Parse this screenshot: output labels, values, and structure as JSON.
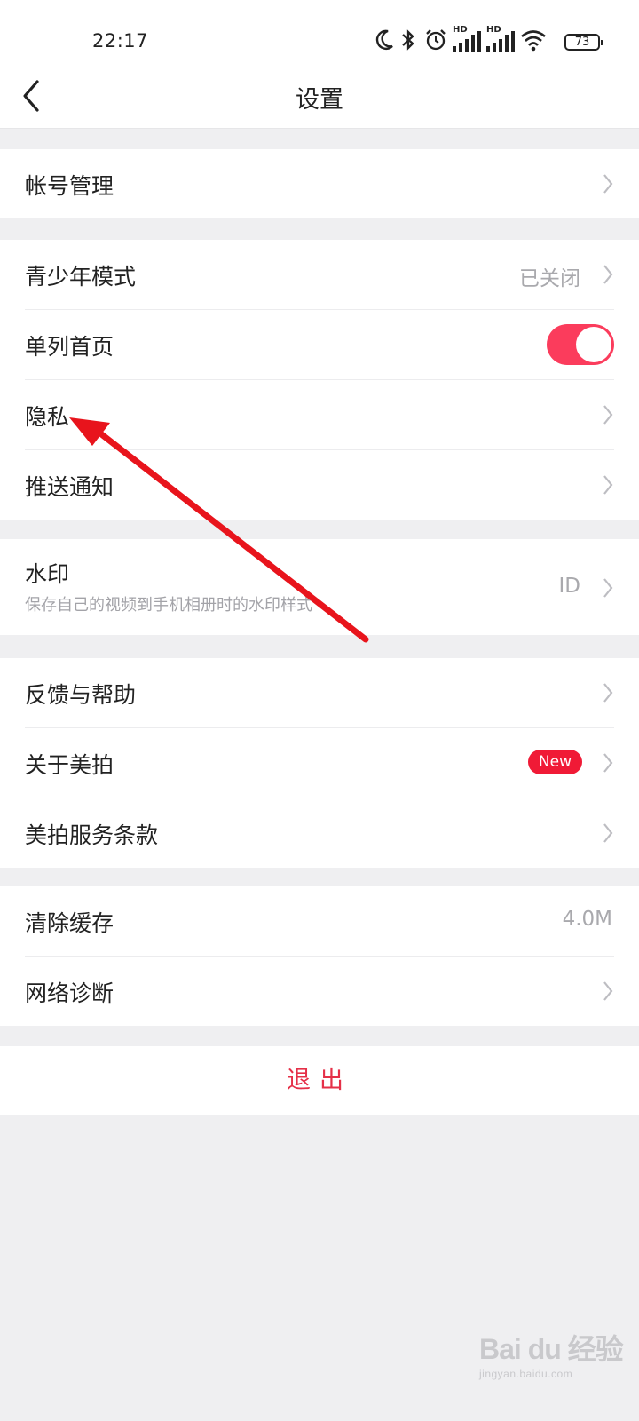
{
  "status_bar": {
    "time": "22:17",
    "battery": "73",
    "icons": [
      "moon-icon",
      "bluetooth-icon",
      "alarm-icon",
      "hd-signal-icon",
      "hd-signal-icon",
      "wifi-icon",
      "battery-icon"
    ],
    "hd_label": "HD"
  },
  "nav": {
    "title": "设置"
  },
  "groups": {
    "account": {
      "label": "帐号管理"
    },
    "youth": {
      "label": "青少年模式",
      "value": "已关闭"
    },
    "single_column": {
      "label": "单列首页",
      "enabled": true
    },
    "privacy": {
      "label": "隐私"
    },
    "push": {
      "label": "推送通知"
    },
    "watermark": {
      "label": "水印",
      "sub": "保存自己的视频到手机相册时的水印样式",
      "value": "ID"
    },
    "feedback": {
      "label": "反馈与帮助"
    },
    "about": {
      "label": "关于美拍",
      "badge": "New"
    },
    "terms": {
      "label": "美拍服务条款"
    },
    "cache": {
      "label": "清除缓存",
      "value": "4.0M"
    },
    "network": {
      "label": "网络诊断"
    }
  },
  "logout": {
    "label": "退出"
  },
  "colors": {
    "accent": "#fb3c5c",
    "badge": "#f01a36",
    "logout": "#e53048",
    "annotation_arrow": "#e8141c"
  },
  "watermark_overlay": {
    "brand": "Bai du 经验",
    "url": "jingyan.baidu.com"
  }
}
